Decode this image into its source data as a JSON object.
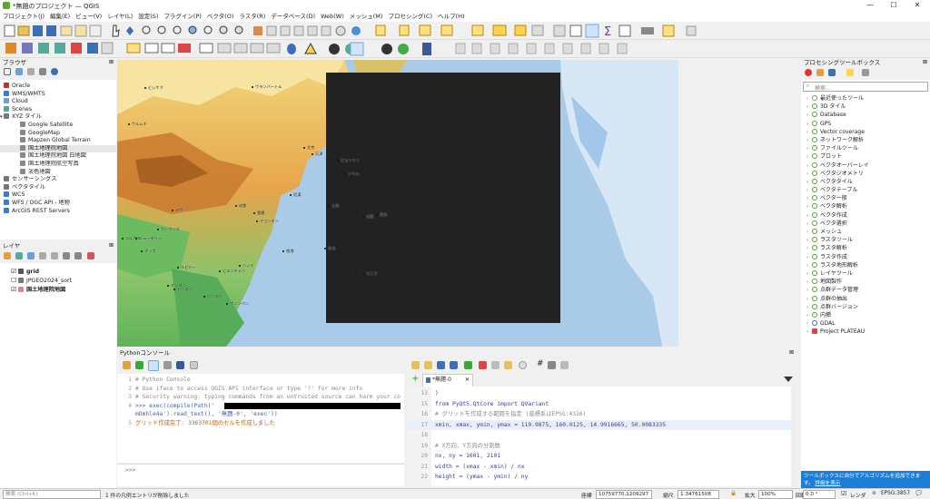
{
  "window": {
    "title": "*無題のプロジェクト — QGIS",
    "minimize": "—",
    "maximize": "☐",
    "close": "✕"
  },
  "menu": [
    "プロジェクト(J)",
    "編集(E)",
    "ビュー(V)",
    "レイヤ(L)",
    "設定(S)",
    "プラグイン(P)",
    "ベクタ(O)",
    "ラスタ(R)",
    "データベース(D)",
    "Web(W)",
    "メッシュ(M)",
    "プロセシング(C)",
    "ヘルプ(H)"
  ],
  "browser": {
    "title": "ブラウザ",
    "items": [
      {
        "label": "Oracle",
        "indent": 0,
        "icon": "database-icon",
        "color": "#b33"
      },
      {
        "label": "WMS/WMTS",
        "indent": 0,
        "icon": "globe-icon",
        "color": "#3a7bd5"
      },
      {
        "label": "Cloud",
        "indent": 0,
        "icon": "cloud-icon",
        "color": "#6a9fd8"
      },
      {
        "label": "Scenes",
        "indent": 0,
        "icon": "scene-icon",
        "color": "#5a8"
      },
      {
        "label": "XYZ タイル",
        "indent": 0,
        "icon": "grid-icon",
        "color": "#777",
        "expanded": true
      },
      {
        "label": "Google Satellite",
        "indent": 1,
        "icon": "tile-icon",
        "color": "#888"
      },
      {
        "label": "GoogleMap",
        "indent": 1,
        "icon": "tile-icon",
        "color": "#888"
      },
      {
        "label": "Mapzen Global Terrain",
        "indent": 1,
        "icon": "tile-icon",
        "color": "#888"
      },
      {
        "label": "国土地理院地図",
        "indent": 1,
        "icon": "tile-icon",
        "color": "#888",
        "selected": true
      },
      {
        "label": "国土地理院地図 白地図",
        "indent": 1,
        "icon": "tile-icon",
        "color": "#888"
      },
      {
        "label": "国土地理院航空写真",
        "indent": 1,
        "icon": "tile-icon",
        "color": "#888"
      },
      {
        "label": "淡色地図",
        "indent": 1,
        "icon": "tile-icon",
        "color": "#888"
      },
      {
        "label": "センサーシングス",
        "indent": 0,
        "icon": "sensor-icon",
        "color": "#777"
      },
      {
        "label": "ベクタタイル",
        "indent": 0,
        "icon": "vectortile-icon",
        "color": "#777"
      },
      {
        "label": "WCS",
        "indent": 0,
        "icon": "globe-icon",
        "color": "#3a7bd5"
      },
      {
        "label": "WFS / OGC API - 地物",
        "indent": 0,
        "icon": "globe-icon",
        "color": "#3a7bd5"
      },
      {
        "label": "ArcGIS REST Servers",
        "indent": 0,
        "icon": "globe-icon",
        "color": "#3a7bd5"
      }
    ]
  },
  "layers": {
    "title": "レイヤ",
    "items": [
      {
        "label": "grid",
        "checked": true,
        "bold": true,
        "icon": "polygon-icon",
        "color": "#555"
      },
      {
        "label": "JPGEO2024_sort",
        "checked": false,
        "bold": false,
        "icon": "table-icon",
        "color": "#777"
      },
      {
        "label": "国土地理院地図",
        "checked": true,
        "bold": true,
        "icon": "raster-icon",
        "color": "#d88"
      }
    ]
  },
  "map": {
    "cities": [
      "ウランバートル",
      "北京",
      "天津",
      "ソウル",
      "ピョンヤン",
      "東京",
      "大阪",
      "上海",
      "武漢",
      "重慶",
      "成都",
      "チョンチン",
      "香港",
      "台北",
      "ハノイ",
      "ビエンチャン",
      "ネピドー",
      "ヤンゴン",
      "バンコク",
      "コルカタ",
      "ダッカ",
      "ニューデリー",
      "カトマンズ",
      "ラサ",
      "マニラ",
      "ビシケク",
      "ウルムチ",
      "ヤンゴン",
      "プノンペン"
    ]
  },
  "python": {
    "title": "Pythonコンソール",
    "console_lines": [
      {
        "n": "1",
        "text": "# Python Console",
        "cls": "cmt"
      },
      {
        "n": "2",
        "text": "# Use iface to access QGIS API interface or type '?' for more info",
        "cls": "cmt"
      },
      {
        "n": "3",
        "text": "# Security warning: typing commands from an untrusted source can harm your computer",
        "cls": "cmt"
      },
      {
        "n": "4",
        "text": ">>> exec(compile(Path('",
        "cls": "code"
      },
      {
        "n": "",
        "text": "mOmhle4a').read_text(), '無題-0', 'exec'))",
        "cls": "code"
      },
      {
        "n": "5",
        "text": "グリッド作成完了: 3363701個のセルを作成しました",
        "cls": "out"
      }
    ],
    "prompt": ">>>",
    "editor_tab": "*無題-0",
    "editor_lines": [
      {
        "n": "13",
        "text": ")"
      },
      {
        "n": "15",
        "text": "from PyQt5.QtCore import QVariant"
      },
      {
        "n": "16",
        "text": "# グリッドを作成する範囲を指定 (座標系はEPSG:4326)"
      },
      {
        "n": "17",
        "text": "xmin, xmax, ymin, ymax = 119.9875, 160.0125, 14.9916665, 50.0083335"
      },
      {
        "n": "18",
        "text": ""
      },
      {
        "n": "19",
        "text": "# X方向、Y方向の分割数"
      },
      {
        "n": "20",
        "text": "nx, ny = 1601, 2101"
      },
      {
        "n": "21",
        "text": "width = (xmax - xmin) / nx"
      },
      {
        "n": "22",
        "text": "height = (ymax - ymin) / ny"
      }
    ]
  },
  "processing": {
    "title": "プロセシングツールボックス",
    "search_placeholder": "検索...",
    "items": [
      {
        "label": "最近使ったツール",
        "icon": "clock-icon"
      },
      {
        "label": "3D タイル",
        "icon": "qgis-icon"
      },
      {
        "label": "Database",
        "icon": "qgis-icon"
      },
      {
        "label": "GPS",
        "icon": "qgis-icon"
      },
      {
        "label": "Vector coverage",
        "icon": "qgis-icon"
      },
      {
        "label": "ネットワーク解析",
        "icon": "qgis-icon"
      },
      {
        "label": "ファイルツール",
        "icon": "qgis-icon"
      },
      {
        "label": "プロット",
        "icon": "qgis-icon"
      },
      {
        "label": "ベクタオーバーレイ",
        "icon": "qgis-icon"
      },
      {
        "label": "ベクタジオメトリ",
        "icon": "qgis-icon"
      },
      {
        "label": "ベクタタイル",
        "icon": "qgis-icon"
      },
      {
        "label": "ベクタテーブル",
        "icon": "qgis-icon"
      },
      {
        "label": "ベクタ一般",
        "icon": "qgis-icon"
      },
      {
        "label": "ベクタ解析",
        "icon": "qgis-icon"
      },
      {
        "label": "ベクタ作成",
        "icon": "qgis-icon"
      },
      {
        "label": "ベクタ選択",
        "icon": "qgis-icon"
      },
      {
        "label": "メッシュ",
        "icon": "qgis-icon"
      },
      {
        "label": "ラスタツール",
        "icon": "qgis-icon"
      },
      {
        "label": "ラスタ解析",
        "icon": "qgis-icon"
      },
      {
        "label": "ラスタ作成",
        "icon": "qgis-icon"
      },
      {
        "label": "ラスタ地形解析",
        "icon": "qgis-icon"
      },
      {
        "label": "レイヤツール",
        "icon": "qgis-icon"
      },
      {
        "label": "地図製作",
        "icon": "qgis-icon"
      },
      {
        "label": "点群データ管理",
        "icon": "qgis-icon"
      },
      {
        "label": "点群の抽出",
        "icon": "qgis-icon"
      },
      {
        "label": "点群バージョン",
        "icon": "qgis-icon"
      },
      {
        "label": "内挿",
        "icon": "qgis-icon"
      },
      {
        "label": "GDAL",
        "icon": "gdal-icon"
      },
      {
        "label": "Project PLATEAU",
        "icon": "plateau-icon"
      }
    ],
    "notice": "ツールボックスに自分でアルゴリズムを追加できます。",
    "notice_link": "詳細を表示"
  },
  "status": {
    "search_placeholder": "検索 (Ctrl+K)",
    "message": "1 件の凡例エントリが削除しました",
    "coord_label": "座標",
    "coord_value": "10759770,1209297",
    "scale_label": "縮尺",
    "scale_value": "1:34761508",
    "magnifier_label": "拡大",
    "magnifier_value": "100%",
    "rotation_label": "回転",
    "rotation_value": "0.0 °",
    "render_label": "レンダ",
    "crs": "EPSG:3857"
  }
}
